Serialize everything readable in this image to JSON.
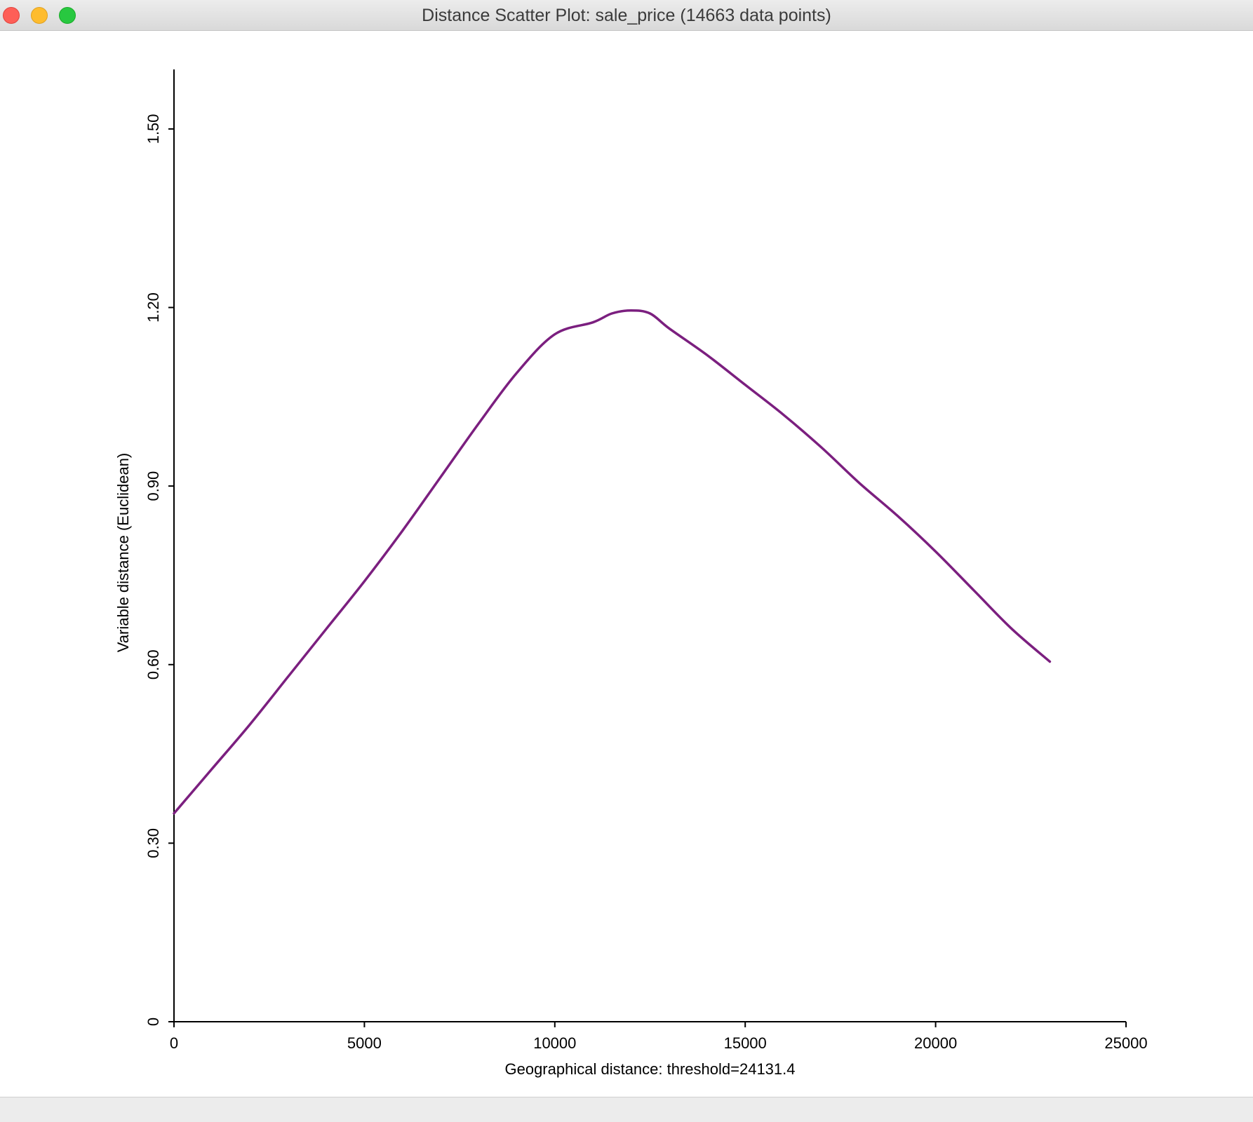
{
  "window": {
    "title": "Distance Scatter Plot: sale_price (14663 data points)"
  },
  "colors": {
    "line": "#7b1f7f",
    "axis": "#000000",
    "background": "#ffffff"
  },
  "chart_data": {
    "type": "line",
    "title": "",
    "xlabel": "Geographical distance: threshold=24131.4",
    "ylabel": "Variable distance (Euclidean)",
    "xlim": [
      0,
      25000
    ],
    "ylim": [
      0,
      1.6
    ],
    "x_ticks": [
      0,
      5000,
      10000,
      15000,
      20000,
      25000
    ],
    "x_tick_labels": [
      "0",
      "5000",
      "10000",
      "15000",
      "20000",
      "25000"
    ],
    "y_ticks": [
      0,
      0.3,
      0.6,
      0.9,
      1.2,
      1.5
    ],
    "y_tick_labels": [
      "0",
      "0.30",
      "0.60",
      "0.90",
      "1.20",
      "1.50"
    ],
    "grid": false,
    "legend": "none",
    "series": [
      {
        "x": [
          0,
          1000,
          2000,
          3000,
          4000,
          5000,
          6000,
          7000,
          8000,
          9000,
          10000,
          11000,
          11500,
          12000,
          12500,
          13000,
          14000,
          15000,
          16000,
          17000,
          18000,
          19000,
          20000,
          21000,
          22000,
          23000
        ],
        "y": [
          0.35,
          0.425,
          0.5,
          0.58,
          0.66,
          0.74,
          0.825,
          0.915,
          1.005,
          1.09,
          1.155,
          1.175,
          1.19,
          1.195,
          1.19,
          1.165,
          1.12,
          1.07,
          1.02,
          0.965,
          0.905,
          0.85,
          0.79,
          0.725,
          0.66,
          0.605
        ]
      }
    ]
  }
}
